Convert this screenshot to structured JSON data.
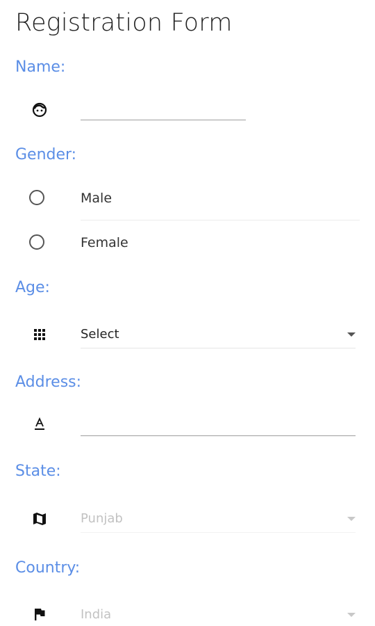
{
  "form": {
    "title": "Registration Form",
    "name": {
      "label": "Name:",
      "icon": "face-icon",
      "value": ""
    },
    "gender": {
      "label": "Gender:",
      "options": [
        {
          "label": "Male",
          "selected": false
        },
        {
          "label": "Female",
          "selected": false
        }
      ]
    },
    "age": {
      "label": "Age:",
      "icon": "dialpad-icon",
      "selected": "Select"
    },
    "address": {
      "label": "Address:",
      "icon": "text-format-icon",
      "value": ""
    },
    "state": {
      "label": "State:",
      "icon": "map-icon",
      "selected": "Punjab",
      "disabled": true
    },
    "country": {
      "label": "Country:",
      "icon": "flag-icon",
      "selected": "India",
      "disabled": true
    }
  },
  "colors": {
    "label": "#5b8ee6",
    "title": "#222222",
    "disabled_text": "#c2c2c2"
  }
}
